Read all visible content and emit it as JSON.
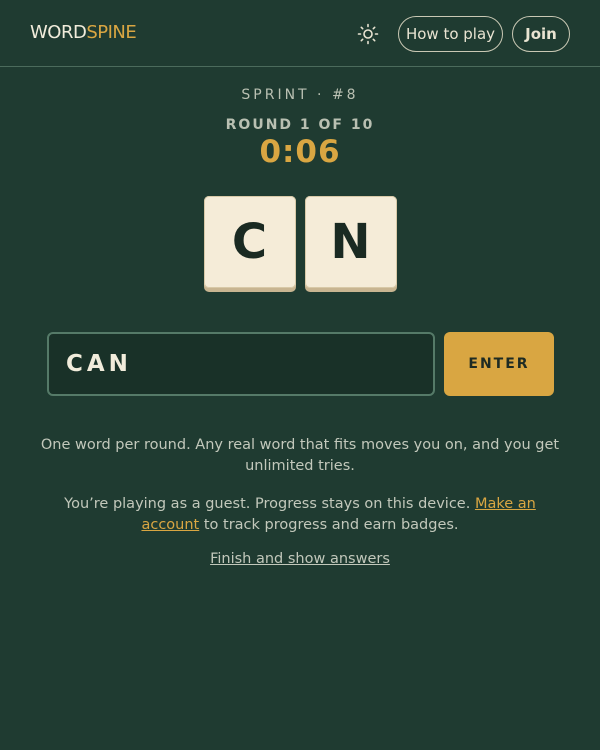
{
  "header": {
    "logo_part1": "WORD",
    "logo_part2": "SPINE",
    "theme_icon": "sun-icon",
    "how_to_play_label": "How to play",
    "join_label": "Join"
  },
  "game": {
    "sprint_label": "SPRINT · #8",
    "round_label": "ROUND 1 OF 10",
    "timer": "0:06",
    "tiles": [
      "C",
      "N"
    ]
  },
  "input": {
    "value": "CAN",
    "enter_label": "ENTER"
  },
  "info": {
    "rules_text": "One word per round. Any real word that fits moves you on, and you get unlimited tries.",
    "guest_text_before": "You’re playing as a guest. Progress stays on this device. ",
    "make_account_link": "Make an account",
    "guest_text_after": " to track progress and earn badges.",
    "finish_link": "Finish and show answers"
  },
  "colors": {
    "background": "#1f3b31",
    "accent": "#d9a642",
    "tile": "#f5ecd8",
    "text": "#c2c8bb"
  }
}
